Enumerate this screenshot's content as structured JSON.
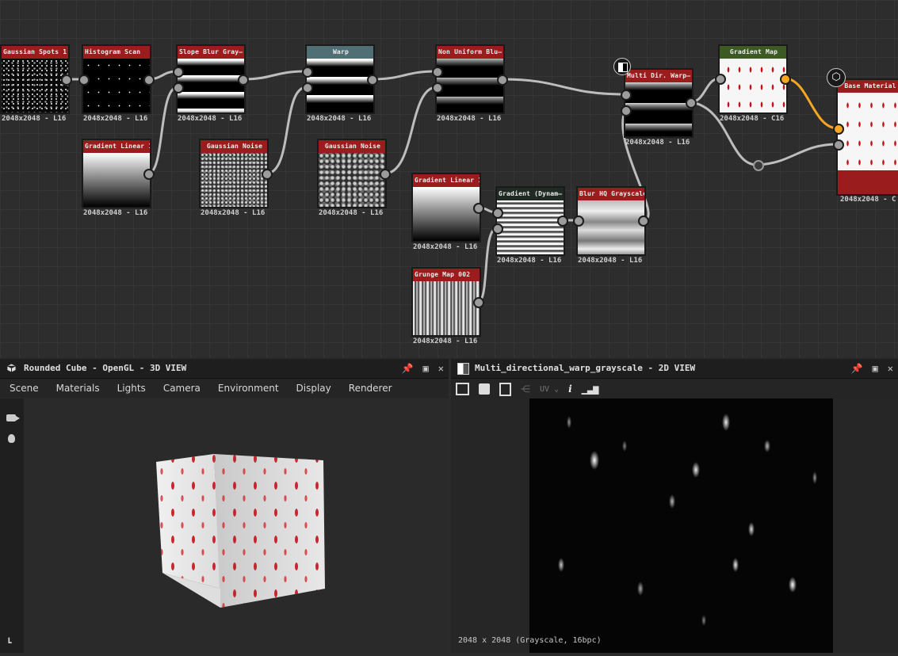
{
  "graph": {
    "nodes": [
      {
        "title": "Gaussian Spots 1",
        "caption": "2048x2048 - L16"
      },
      {
        "title": "Histogram Scan",
        "caption": "2048x2048 - L16"
      },
      {
        "title": "Slope Blur Gray—",
        "caption": "2048x2048 - L16"
      },
      {
        "title": "Warp",
        "caption": "2048x2048 - L16"
      },
      {
        "title": "Non Uniform Blu—",
        "caption": "2048x2048 - L16"
      },
      {
        "title": "Multi Dir. Warp—",
        "caption": "2048x2048 - L16"
      },
      {
        "title": "Gradient Map",
        "caption": "2048x2048 - C16"
      },
      {
        "title": "Base Material",
        "caption": "2048x2048 - C"
      },
      {
        "title": "Gradient Linear 1",
        "caption": "2048x2048 - L16"
      },
      {
        "title": "Gaussian Noise",
        "caption": "2048x2048 - L16"
      },
      {
        "title": "Gaussian Noise",
        "caption": "2048x2048 - L16"
      },
      {
        "title": "Gradient Linear 1",
        "caption": "2048x2048 - L16"
      },
      {
        "title": "Gradient (Dynam—",
        "caption": "2048x2048 - L16"
      },
      {
        "title": "Blur HQ Grayscale",
        "caption": "2048x2048 - L16"
      },
      {
        "title": "Grunge Map 002",
        "caption": "2048x2048 - L16"
      }
    ]
  },
  "view3d": {
    "title": "Rounded Cube - OpenGL - 3D VIEW",
    "menu": [
      "Scene",
      "Materials",
      "Lights",
      "Camera",
      "Environment",
      "Display",
      "Renderer"
    ]
  },
  "view2d": {
    "title": "Multi_directional_warp_grayscale - 2D VIEW",
    "uv_label": "UV",
    "status": "2048 x 2048 (Grayscale, 16bpc)"
  },
  "colors": {
    "node_header_red": "#9a1c1c",
    "accent_orange": "#f5a623",
    "panel_bg": "#282828"
  }
}
